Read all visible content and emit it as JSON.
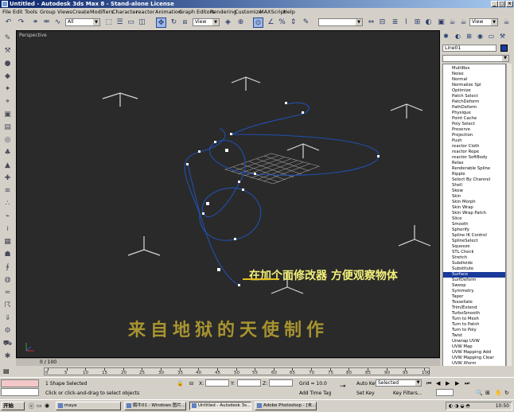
{
  "window": {
    "title": "Untitled - Autodesk 3ds Max 8  - Stand-alone License",
    "min": "_",
    "max": "□",
    "close": "×"
  },
  "menu": [
    "File",
    "Edit",
    "Tools",
    "Group",
    "Views",
    "Create",
    "Modifiers",
    "Character",
    "reactor",
    "Animation",
    "Graph Editors",
    "Rendering",
    "Customize",
    "MAXScript",
    "Help"
  ],
  "toolbar": {
    "selection_filter": "All",
    "ref_coord": "View",
    "named_sel": "",
    "view_right": "View"
  },
  "viewport": {
    "label": "Perspective",
    "caption": "在加个面修改器 方便观察物体",
    "watermark": "来自地狱的天使制作"
  },
  "command_panel": {
    "object_name": "Line01",
    "object_color": "#1a3aa0",
    "modifiers": [
      "MultiRes",
      "Noise",
      "Normal",
      "Normalize Spl",
      "Optimize",
      "Patch Select",
      "PatchDeform",
      "PathDeform",
      "Physique",
      "Point Cache",
      "Poly Select",
      "Preserve",
      "Projection",
      "Push",
      "reactor Cloth",
      "reactor Rope",
      "reactor SoftBody",
      "Relax",
      "Renderable Spline",
      "Ripple",
      "Select By Channel",
      "Shell",
      "Skew",
      "Skin",
      "Skin Morph",
      "Skin Wrap",
      "Skin Wrap Patch",
      "Slice",
      "Smooth",
      "Spherify",
      "Spline IK Control",
      "SplineSelect",
      "Squeeze",
      "STL Check",
      "Stretch",
      "Subdivide",
      "Substitute",
      "Surface",
      "SurfDeform",
      "Sweep",
      "Symmetry",
      "Taper",
      "Tessellate",
      "Trim/Extend",
      "TurboSmooth",
      "Turn to Mesh",
      "Turn to Patch",
      "Turn to Poly",
      "Twist",
      "Unwrap UVW",
      "UVW Map",
      "UVW Mapping Add",
      "UVW Mapping Clear",
      "UVW Xform",
      "Vertex Weld",
      "VertexPaint",
      "Vol. Select",
      "Wave",
      "XForm"
    ],
    "selected_modifier": "Surface"
  },
  "timeline": {
    "time_text": "0 / 100",
    "ticks": [
      "0",
      "5",
      "10",
      "15",
      "20",
      "25",
      "30",
      "35",
      "40",
      "45",
      "50",
      "55",
      "60",
      "65",
      "70",
      "75",
      "80",
      "85",
      "90",
      "95",
      "100"
    ]
  },
  "status": {
    "selected": "1 Shape Selected",
    "prompt": "Click or click-and-drag to select objects",
    "x_label": "X:",
    "y_label": "Y:",
    "z_label": "Z:",
    "grid": "Grid = 10.0",
    "add_time_tag": "Add Time Tag",
    "auto_key": "Auto Key",
    "set_key": "Set Key",
    "key_mode": "Selected",
    "key_filters": "Key Filters..."
  },
  "taskbar": {
    "start": "开始",
    "tasks": [
      "maya",
      "鹅牛01 - Windows 图片...",
      "Untitled - Autodesk 3s...",
      "Adobe Photoshop - [未..."
    ],
    "active_task": 2,
    "clock": "10:50"
  }
}
